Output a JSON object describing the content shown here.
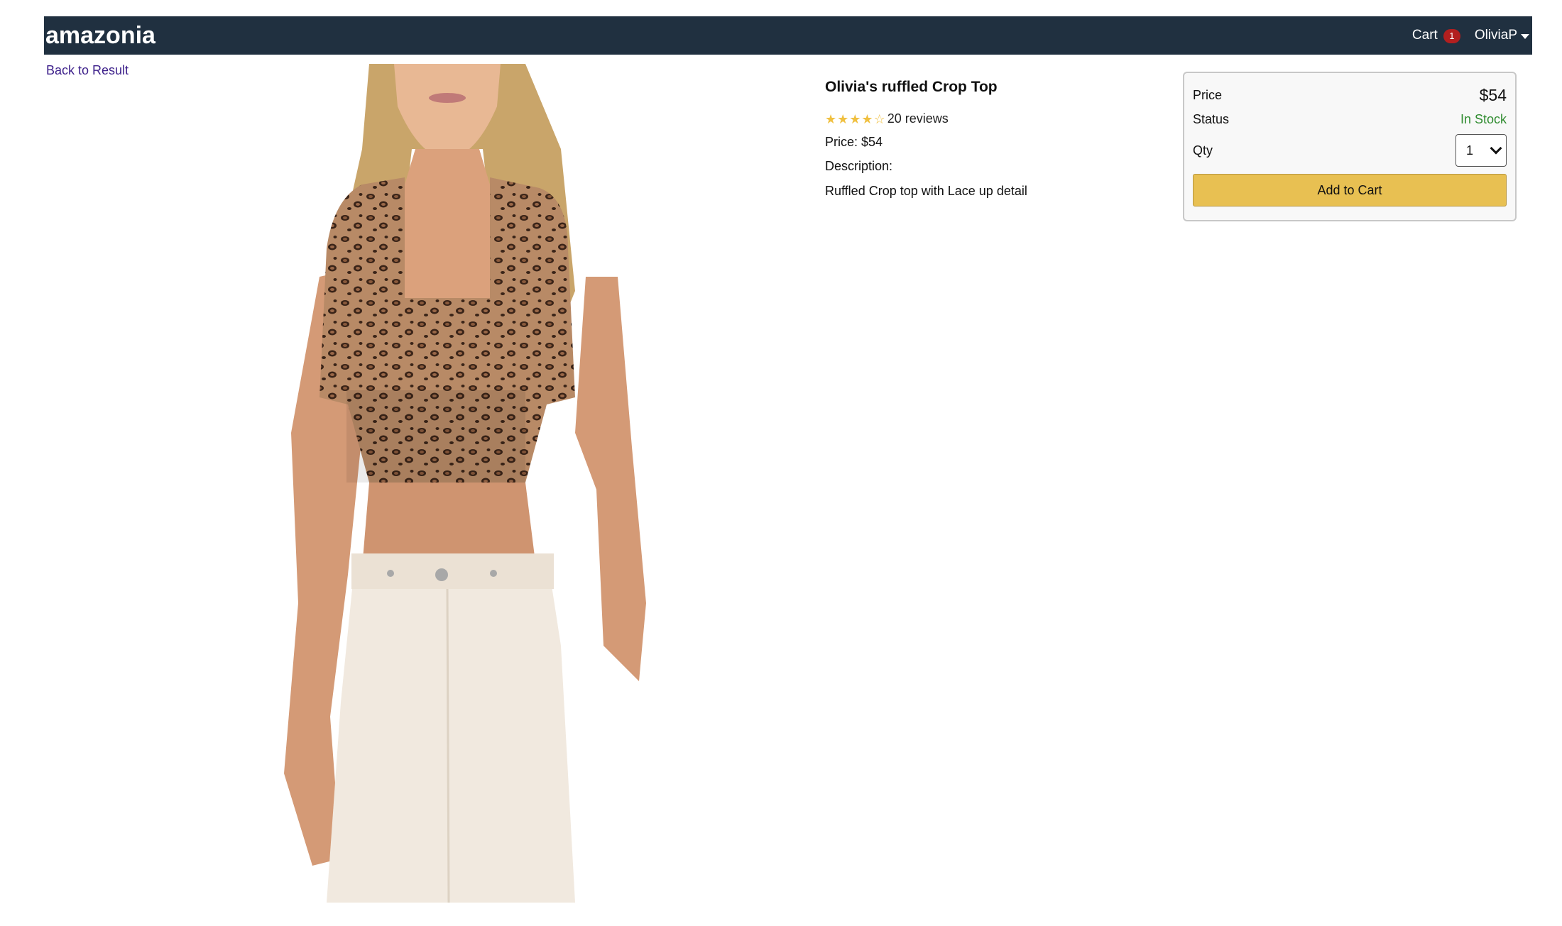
{
  "header": {
    "brand": "amazonia",
    "cart_label": "Cart",
    "cart_count": "1",
    "user_name": "OliviaP"
  },
  "nav": {
    "back_label": "Back to Result"
  },
  "product": {
    "title": "Olivia's ruffled Crop Top",
    "rating": 3.5,
    "rating_max": 5,
    "reviews_text": "20 reviews",
    "price_line": "Price: $54",
    "description_label": "Description:",
    "description": "Ruffled Crop top with Lace up detail",
    "image_subject": "model wearing leopard-print ruffled crop top and white jeans"
  },
  "buy_box": {
    "price_label": "Price",
    "price_value": "$54",
    "status_label": "Status",
    "status_value": "In Stock",
    "qty_label": "Qty",
    "qty_value": "1",
    "add_button": "Add to Cart"
  },
  "colors": {
    "header_bg": "#203040",
    "badge": "#b21f1f",
    "star": "#f0c040",
    "in_stock": "#2e8b2e",
    "button": "#e8c052",
    "link": "#3c1f8a"
  }
}
